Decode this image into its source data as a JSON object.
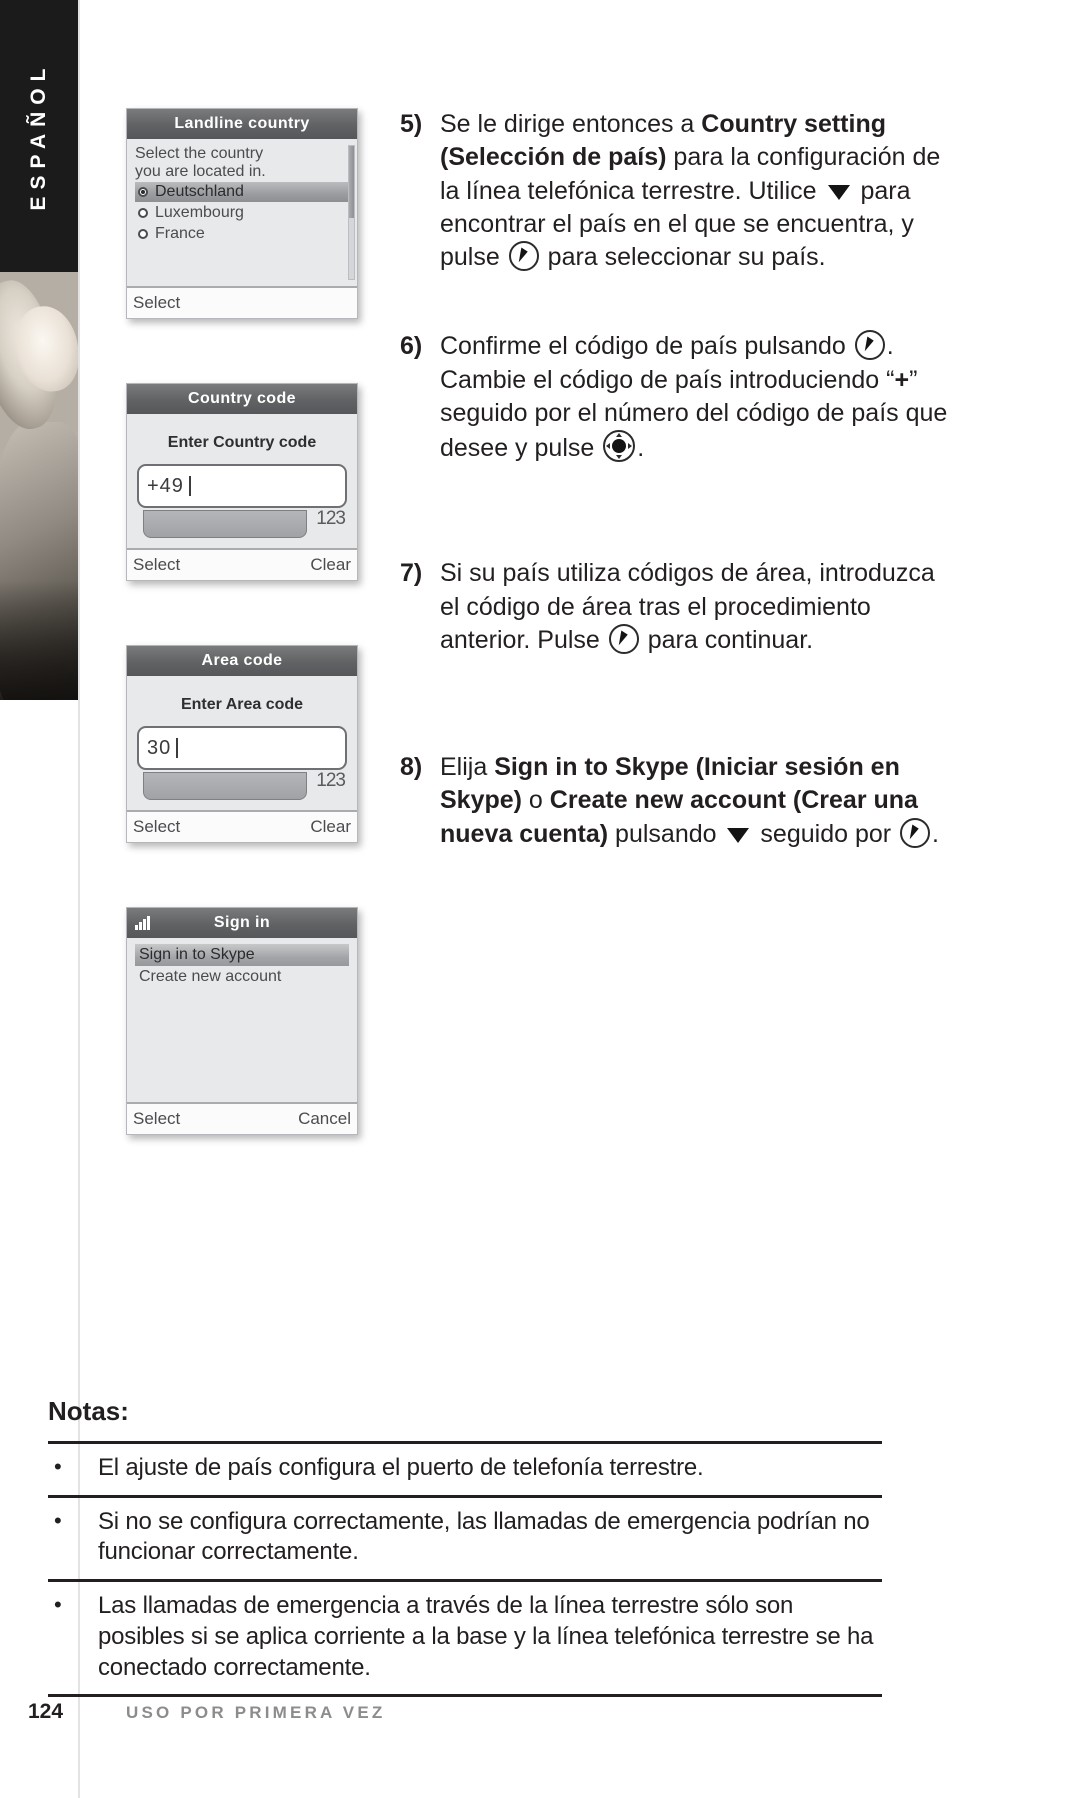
{
  "sidebar": {
    "language_tab": "ESPAÑOL",
    "photo_alt": "woman-photo"
  },
  "screens": [
    {
      "id": "landline-country",
      "title": "Landline country",
      "hint_lines": [
        "Select the country",
        "you are located in."
      ],
      "options": [
        {
          "label": "Deutschland",
          "selected": true
        },
        {
          "label": "Luxembourg",
          "selected": false
        },
        {
          "label": "France",
          "selected": false
        }
      ],
      "softkey_left": "Select",
      "softkey_right": ""
    },
    {
      "id": "country-code",
      "title": "Country code",
      "heading": "Enter Country code",
      "input_value": "+49",
      "input_mode": "123",
      "softkey_left": "Select",
      "softkey_right": "Clear"
    },
    {
      "id": "area-code",
      "title": "Area code",
      "heading": "Enter Area code",
      "input_value": "30",
      "input_mode": "123",
      "softkey_left": "Select",
      "softkey_right": "Clear"
    },
    {
      "id": "sign-in",
      "title": "Sign in",
      "status_icon": "signal-icon",
      "menu": [
        {
          "label": "Sign in to Skype",
          "selected": true
        },
        {
          "label": "Create new account",
          "selected": false
        }
      ],
      "softkey_left": "Select",
      "softkey_right": "Cancel"
    }
  ],
  "steps": [
    {
      "number": "5)",
      "parts": [
        {
          "t": "text",
          "v": "Se le dirige entonces a "
        },
        {
          "t": "bold",
          "v": "Country setting (Selección de país)"
        },
        {
          "t": "text",
          "v": " para la configuración de la línea telefónica terrestre. Utilice "
        },
        {
          "t": "icon",
          "v": "down-arrow-icon"
        },
        {
          "t": "text",
          "v": " para encontrar el país en el que se encuentra, y pulse "
        },
        {
          "t": "icon",
          "v": "ok-circle-icon"
        },
        {
          "t": "text",
          "v": " para seleccionar su país."
        }
      ]
    },
    {
      "number": "6)",
      "parts": [
        {
          "t": "text",
          "v": "Confirme el código de país pulsando "
        },
        {
          "t": "icon",
          "v": "ok-circle-icon"
        },
        {
          "t": "text",
          "v": ". Cambie el código de país introduciendo “"
        },
        {
          "t": "bold",
          "v": "+"
        },
        {
          "t": "text",
          "v": "” seguido por el número del código de país que desee y pulse "
        },
        {
          "t": "icon",
          "v": "nav-pad-icon"
        },
        {
          "t": "text",
          "v": "."
        }
      ]
    },
    {
      "number": "7)",
      "parts": [
        {
          "t": "text",
          "v": "Si su país utiliza códigos de área, introduzca el código de área tras el procedimiento anterior. Pulse "
        },
        {
          "t": "icon",
          "v": "ok-circle-icon"
        },
        {
          "t": "text",
          "v": " para continuar."
        }
      ]
    },
    {
      "number": "8)",
      "parts": [
        {
          "t": "text",
          "v": "Elija "
        },
        {
          "t": "bold",
          "v": "Sign in to Skype (Iniciar sesión en Skype)"
        },
        {
          "t": "text",
          "v": " o "
        },
        {
          "t": "bold",
          "v": "Create new account (Crear una nueva cuenta)"
        },
        {
          "t": "text",
          "v": " pulsando "
        },
        {
          "t": "icon",
          "v": "down-arrow-icon"
        },
        {
          "t": "text",
          "v": " seguido por "
        },
        {
          "t": "icon",
          "v": "ok-circle-icon"
        },
        {
          "t": "text",
          "v": "."
        }
      ]
    }
  ],
  "notes": {
    "title": "Notas:",
    "bullet": "•",
    "items": [
      "El ajuste de país configura el puerto de telefonía terrestre.",
      "Si no se configura correctamente, las llamadas de emergencia podrían no funcionar correctamente.",
      "Las llamadas de emergencia a través de la línea terrestre sólo son posibles si se aplica corriente a la base y la línea telefónica terrestre se ha conectado correctamente."
    ]
  },
  "footer": {
    "page_number": "124",
    "section_label": "USO POR PRIMERA VEZ"
  },
  "colors": {
    "tab_background": "#1b1b1b",
    "text": "#231f20",
    "lcd_titlebar": "#616264",
    "lcd_background": "#e8e9eb",
    "footer_label": "#8c8c8c"
  }
}
